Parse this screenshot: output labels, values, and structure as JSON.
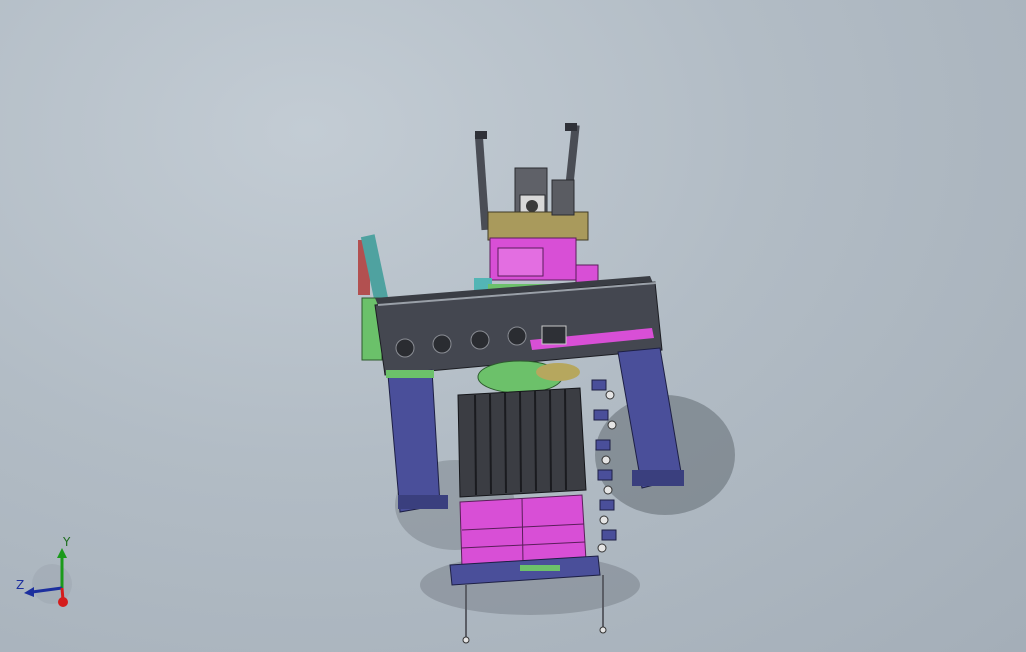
{
  "viewport": {
    "background": "#b4bec7",
    "colors": {
      "frame_dark": "#3a3d44",
      "column_blue": "#4a4f9a",
      "magenta": "#d84fd6",
      "green": "#6cc16a",
      "olive": "#9a8e55",
      "shadow": "#6b747c"
    }
  },
  "triad": {
    "y_label": "Y",
    "z_label": "Z",
    "icon": "coordinate-triad-icon"
  }
}
